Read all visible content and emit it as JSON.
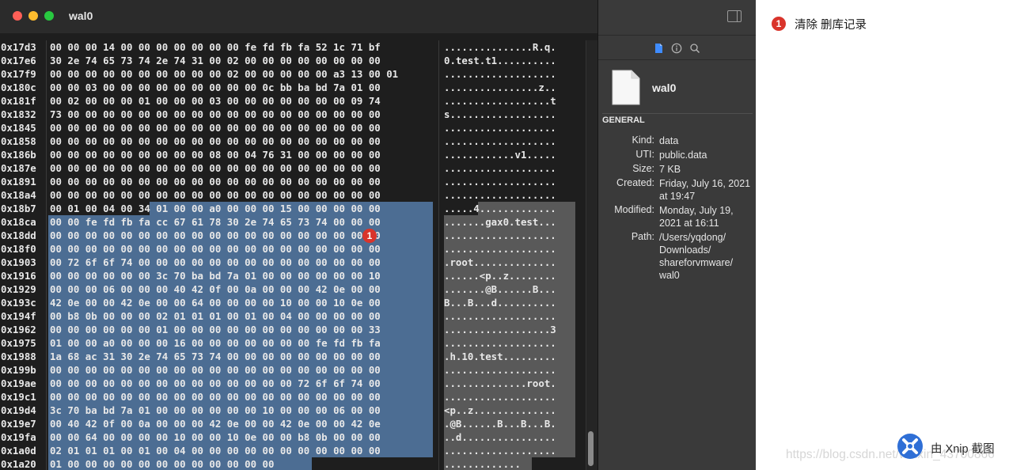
{
  "window": {
    "title": "wal0"
  },
  "hex_rows": [
    {
      "addr": "0x17d3",
      "bytes": "00 00 00 14 00 00 00 00 00 00 00 fe fd fb fa 52 1c 71 bf",
      "ascii": "...............R.q."
    },
    {
      "addr": "0x17e6",
      "bytes": "30 2e 74 65 73 74 2e 74 31 00 02 00 00 00 00 00 00 00 00",
      "ascii": "0.test.t1.........."
    },
    {
      "addr": "0x17f9",
      "bytes": "00 00 00 00 00 00 00 00 00 00 02 00 00 00 00 00 a3 13 00 01",
      "ascii": "..................."
    },
    {
      "addr": "0x180c",
      "bytes": "00 00 03 00 00 00 00 00 00 00 00 00 0c bb ba bd 7a 01 00",
      "ascii": "................z.."
    },
    {
      "addr": "0x181f",
      "bytes": "00 02 00 00 00 01 00 00 00 03 00 00 00 00 00 00 00 09 74",
      "ascii": "..................t"
    },
    {
      "addr": "0x1832",
      "bytes": "73 00 00 00 00 00 00 00 00 00 00 00 00 00 00 00 00 00 00",
      "ascii": "s.................."
    },
    {
      "addr": "0x1845",
      "bytes": "00 00 00 00 00 00 00 00 00 00 00 00 00 00 00 00 00 00 00",
      "ascii": "..................."
    },
    {
      "addr": "0x1858",
      "bytes": "00 00 00 00 00 00 00 00 00 00 00 00 00 00 00 00 00 00 00",
      "ascii": "..................."
    },
    {
      "addr": "0x186b",
      "bytes": "00 00 00 00 00 00 00 00 00 08 00 04 76 31 00 00 00 00 00",
      "ascii": "............v1....."
    },
    {
      "addr": "0x187e",
      "bytes": "00 00 00 00 00 00 00 00 00 00 00 00 00 00 00 00 00 00 00",
      "ascii": "..................."
    },
    {
      "addr": "0x1891",
      "bytes": "00 00 00 00 00 00 00 00 00 00 00 00 00 00 00 00 00 00 00",
      "ascii": "..................."
    },
    {
      "addr": "0x18a4",
      "bytes": "00 00 00 00 00 00 00 00 00 00 00 00 00 00 00 00 00 00 00",
      "ascii": "..................."
    },
    {
      "addr": "0x18b7",
      "bytes": "00 01 00 04 00 34 01 00 00 a0 00 00 00 15 00 00 00 00 00",
      "ascii": ".....4............."
    },
    {
      "addr": "0x18ca",
      "bytes": "00 00 fe fd fb fa cc 67 61 78 30 2e 74 65 73 74 00 00 00",
      "ascii": ".......gax0.test..."
    },
    {
      "addr": "0x18dd",
      "bytes": "00 00 00 00 00 00 00 00 00 00 00 00 00 00 00 00 00 00 00",
      "ascii": "..................."
    },
    {
      "addr": "0x18f0",
      "bytes": "00 00 00 00 00 00 00 00 00 00 00 00 00 00 00 00 00 00 00",
      "ascii": "..................."
    },
    {
      "addr": "0x1903",
      "bytes": "00 72 6f 6f 74 00 00 00 00 00 00 00 00 00 00 00 00 00 00",
      "ascii": ".root.............."
    },
    {
      "addr": "0x1916",
      "bytes": "00 00 00 00 00 00 3c 70 ba bd 7a 01 00 00 00 00 00 00 10",
      "ascii": "......<p..z........"
    },
    {
      "addr": "0x1929",
      "bytes": "00 00 00 06 00 00 00 40 42 0f 00 0a 00 00 00 42 0e 00 00",
      "ascii": ".......@B......B..."
    },
    {
      "addr": "0x193c",
      "bytes": "42 0e 00 00 42 0e 00 00 64 00 00 00 00 10 00 00 10 0e 00",
      "ascii": "B...B...d.........."
    },
    {
      "addr": "0x194f",
      "bytes": "00 b8 0b 00 00 00 02 01 01 01 00 01 00 04 00 00 00 00 00",
      "ascii": "..................."
    },
    {
      "addr": "0x1962",
      "bytes": "00 00 00 00 00 00 01 00 00 00 00 00 00 00 00 00 00 00 33",
      "ascii": "..................3"
    },
    {
      "addr": "0x1975",
      "bytes": "01 00 00 a0 00 00 00 16 00 00 00 00 00 00 00 fe fd fb fa",
      "ascii": "..................."
    },
    {
      "addr": "0x1988",
      "bytes": "1a 68 ac 31 30 2e 74 65 73 74 00 00 00 00 00 00 00 00 00",
      "ascii": ".h.10.test........."
    },
    {
      "addr": "0x199b",
      "bytes": "00 00 00 00 00 00 00 00 00 00 00 00 00 00 00 00 00 00 00",
      "ascii": "..................."
    },
    {
      "addr": "0x19ae",
      "bytes": "00 00 00 00 00 00 00 00 00 00 00 00 00 00 72 6f 6f 74 00",
      "ascii": "..............root."
    },
    {
      "addr": "0x19c1",
      "bytes": "00 00 00 00 00 00 00 00 00 00 00 00 00 00 00 00 00 00 00",
      "ascii": "..................."
    },
    {
      "addr": "0x19d4",
      "bytes": "3c 70 ba bd 7a 01 00 00 00 00 00 00 10 00 00 00 06 00 00",
      "ascii": "<p..z.............."
    },
    {
      "addr": "0x19e7",
      "bytes": "00 40 42 0f 00 0a 00 00 00 42 0e 00 00 42 0e 00 00 42 0e",
      "ascii": ".@B......B...B...B."
    },
    {
      "addr": "0x19fa",
      "bytes": "00 00 64 00 00 00 00 10 00 00 10 0e 00 00 b8 0b 00 00 00",
      "ascii": "..d................"
    },
    {
      "addr": "0x1a0d",
      "bytes": "02 01 01 01 00 01 00 04 00 00 00 00 00 00 00 00 00 00 00",
      "ascii": "..................."
    },
    {
      "addr": "0x1a20",
      "bytes": "01 00 00 00 00 00 00 00 00 00 00 00 00",
      "ascii": "............."
    }
  ],
  "marker": {
    "number": "1",
    "legend": "清除 删库记录"
  },
  "info": {
    "file_name": "wal0",
    "section": "GENERAL",
    "props": [
      {
        "label": "Kind:",
        "value": "data"
      },
      {
        "label": "UTI:",
        "value": "public.data"
      },
      {
        "label": "Size:",
        "value": "7 KB"
      },
      {
        "label": "Created:",
        "value": "Friday, July 16, 2021 at 19:47"
      },
      {
        "label": "Modified:",
        "value": "Monday, July 19, 2021 at 16:11"
      },
      {
        "label": "Path:",
        "value": "/Users/yqdong/ Downloads/ shareforvmware/ wal0"
      }
    ]
  },
  "watermark": "https://blog.csdn.net/weixin_43700866",
  "xnip": {
    "label": "由 Xnip 截图"
  },
  "colors": {
    "selection": "#4c6d93",
    "ascii_selection": "#595959",
    "marker": "#d9342b"
  }
}
